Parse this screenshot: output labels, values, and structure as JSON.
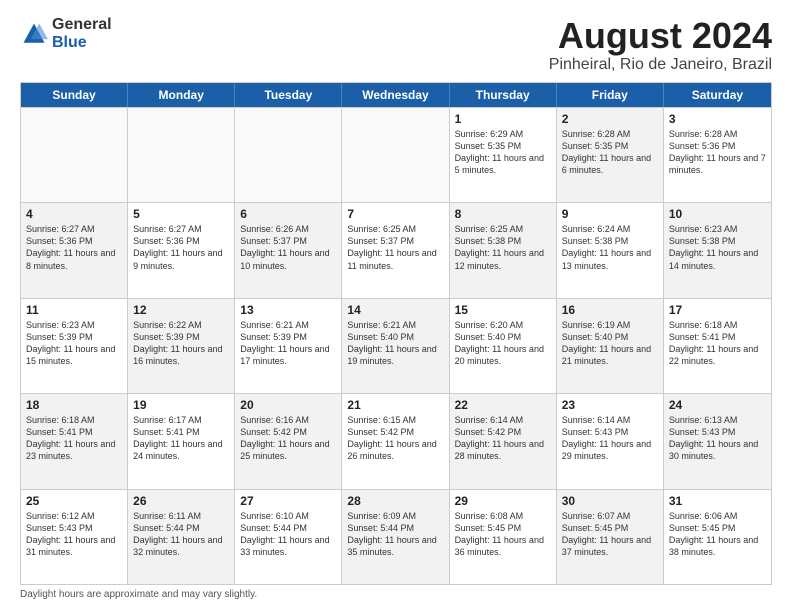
{
  "logo": {
    "general": "General",
    "blue": "Blue"
  },
  "title": {
    "month_year": "August 2024",
    "location": "Pinheiral, Rio de Janeiro, Brazil"
  },
  "days_of_week": [
    "Sunday",
    "Monday",
    "Tuesday",
    "Wednesday",
    "Thursday",
    "Friday",
    "Saturday"
  ],
  "weeks": [
    [
      {
        "day": "",
        "info": "",
        "shaded": false,
        "empty": true
      },
      {
        "day": "",
        "info": "",
        "shaded": false,
        "empty": true
      },
      {
        "day": "",
        "info": "",
        "shaded": false,
        "empty": true
      },
      {
        "day": "",
        "info": "",
        "shaded": false,
        "empty": true
      },
      {
        "day": "1",
        "info": "Sunrise: 6:29 AM\nSunset: 5:35 PM\nDaylight: 11 hours and 5 minutes.",
        "shaded": false,
        "empty": false
      },
      {
        "day": "2",
        "info": "Sunrise: 6:28 AM\nSunset: 5:35 PM\nDaylight: 11 hours and 6 minutes.",
        "shaded": true,
        "empty": false
      },
      {
        "day": "3",
        "info": "Sunrise: 6:28 AM\nSunset: 5:36 PM\nDaylight: 11 hours and 7 minutes.",
        "shaded": false,
        "empty": false
      }
    ],
    [
      {
        "day": "4",
        "info": "Sunrise: 6:27 AM\nSunset: 5:36 PM\nDaylight: 11 hours and 8 minutes.",
        "shaded": true,
        "empty": false
      },
      {
        "day": "5",
        "info": "Sunrise: 6:27 AM\nSunset: 5:36 PM\nDaylight: 11 hours and 9 minutes.",
        "shaded": false,
        "empty": false
      },
      {
        "day": "6",
        "info": "Sunrise: 6:26 AM\nSunset: 5:37 PM\nDaylight: 11 hours and 10 minutes.",
        "shaded": true,
        "empty": false
      },
      {
        "day": "7",
        "info": "Sunrise: 6:25 AM\nSunset: 5:37 PM\nDaylight: 11 hours and 11 minutes.",
        "shaded": false,
        "empty": false
      },
      {
        "day": "8",
        "info": "Sunrise: 6:25 AM\nSunset: 5:38 PM\nDaylight: 11 hours and 12 minutes.",
        "shaded": true,
        "empty": false
      },
      {
        "day": "9",
        "info": "Sunrise: 6:24 AM\nSunset: 5:38 PM\nDaylight: 11 hours and 13 minutes.",
        "shaded": false,
        "empty": false
      },
      {
        "day": "10",
        "info": "Sunrise: 6:23 AM\nSunset: 5:38 PM\nDaylight: 11 hours and 14 minutes.",
        "shaded": true,
        "empty": false
      }
    ],
    [
      {
        "day": "11",
        "info": "Sunrise: 6:23 AM\nSunset: 5:39 PM\nDaylight: 11 hours and 15 minutes.",
        "shaded": false,
        "empty": false
      },
      {
        "day": "12",
        "info": "Sunrise: 6:22 AM\nSunset: 5:39 PM\nDaylight: 11 hours and 16 minutes.",
        "shaded": true,
        "empty": false
      },
      {
        "day": "13",
        "info": "Sunrise: 6:21 AM\nSunset: 5:39 PM\nDaylight: 11 hours and 17 minutes.",
        "shaded": false,
        "empty": false
      },
      {
        "day": "14",
        "info": "Sunrise: 6:21 AM\nSunset: 5:40 PM\nDaylight: 11 hours and 19 minutes.",
        "shaded": true,
        "empty": false
      },
      {
        "day": "15",
        "info": "Sunrise: 6:20 AM\nSunset: 5:40 PM\nDaylight: 11 hours and 20 minutes.",
        "shaded": false,
        "empty": false
      },
      {
        "day": "16",
        "info": "Sunrise: 6:19 AM\nSunset: 5:40 PM\nDaylight: 11 hours and 21 minutes.",
        "shaded": true,
        "empty": false
      },
      {
        "day": "17",
        "info": "Sunrise: 6:18 AM\nSunset: 5:41 PM\nDaylight: 11 hours and 22 minutes.",
        "shaded": false,
        "empty": false
      }
    ],
    [
      {
        "day": "18",
        "info": "Sunrise: 6:18 AM\nSunset: 5:41 PM\nDaylight: 11 hours and 23 minutes.",
        "shaded": true,
        "empty": false
      },
      {
        "day": "19",
        "info": "Sunrise: 6:17 AM\nSunset: 5:41 PM\nDaylight: 11 hours and 24 minutes.",
        "shaded": false,
        "empty": false
      },
      {
        "day": "20",
        "info": "Sunrise: 6:16 AM\nSunset: 5:42 PM\nDaylight: 11 hours and 25 minutes.",
        "shaded": true,
        "empty": false
      },
      {
        "day": "21",
        "info": "Sunrise: 6:15 AM\nSunset: 5:42 PM\nDaylight: 11 hours and 26 minutes.",
        "shaded": false,
        "empty": false
      },
      {
        "day": "22",
        "info": "Sunrise: 6:14 AM\nSunset: 5:42 PM\nDaylight: 11 hours and 28 minutes.",
        "shaded": true,
        "empty": false
      },
      {
        "day": "23",
        "info": "Sunrise: 6:14 AM\nSunset: 5:43 PM\nDaylight: 11 hours and 29 minutes.",
        "shaded": false,
        "empty": false
      },
      {
        "day": "24",
        "info": "Sunrise: 6:13 AM\nSunset: 5:43 PM\nDaylight: 11 hours and 30 minutes.",
        "shaded": true,
        "empty": false
      }
    ],
    [
      {
        "day": "25",
        "info": "Sunrise: 6:12 AM\nSunset: 5:43 PM\nDaylight: 11 hours and 31 minutes.",
        "shaded": false,
        "empty": false
      },
      {
        "day": "26",
        "info": "Sunrise: 6:11 AM\nSunset: 5:44 PM\nDaylight: 11 hours and 32 minutes.",
        "shaded": true,
        "empty": false
      },
      {
        "day": "27",
        "info": "Sunrise: 6:10 AM\nSunset: 5:44 PM\nDaylight: 11 hours and 33 minutes.",
        "shaded": false,
        "empty": false
      },
      {
        "day": "28",
        "info": "Sunrise: 6:09 AM\nSunset: 5:44 PM\nDaylight: 11 hours and 35 minutes.",
        "shaded": true,
        "empty": false
      },
      {
        "day": "29",
        "info": "Sunrise: 6:08 AM\nSunset: 5:45 PM\nDaylight: 11 hours and 36 minutes.",
        "shaded": false,
        "empty": false
      },
      {
        "day": "30",
        "info": "Sunrise: 6:07 AM\nSunset: 5:45 PM\nDaylight: 11 hours and 37 minutes.",
        "shaded": true,
        "empty": false
      },
      {
        "day": "31",
        "info": "Sunrise: 6:06 AM\nSunset: 5:45 PM\nDaylight: 11 hours and 38 minutes.",
        "shaded": false,
        "empty": false
      }
    ]
  ],
  "footer": {
    "note": "Daylight hours are approximate and may vary slightly."
  }
}
